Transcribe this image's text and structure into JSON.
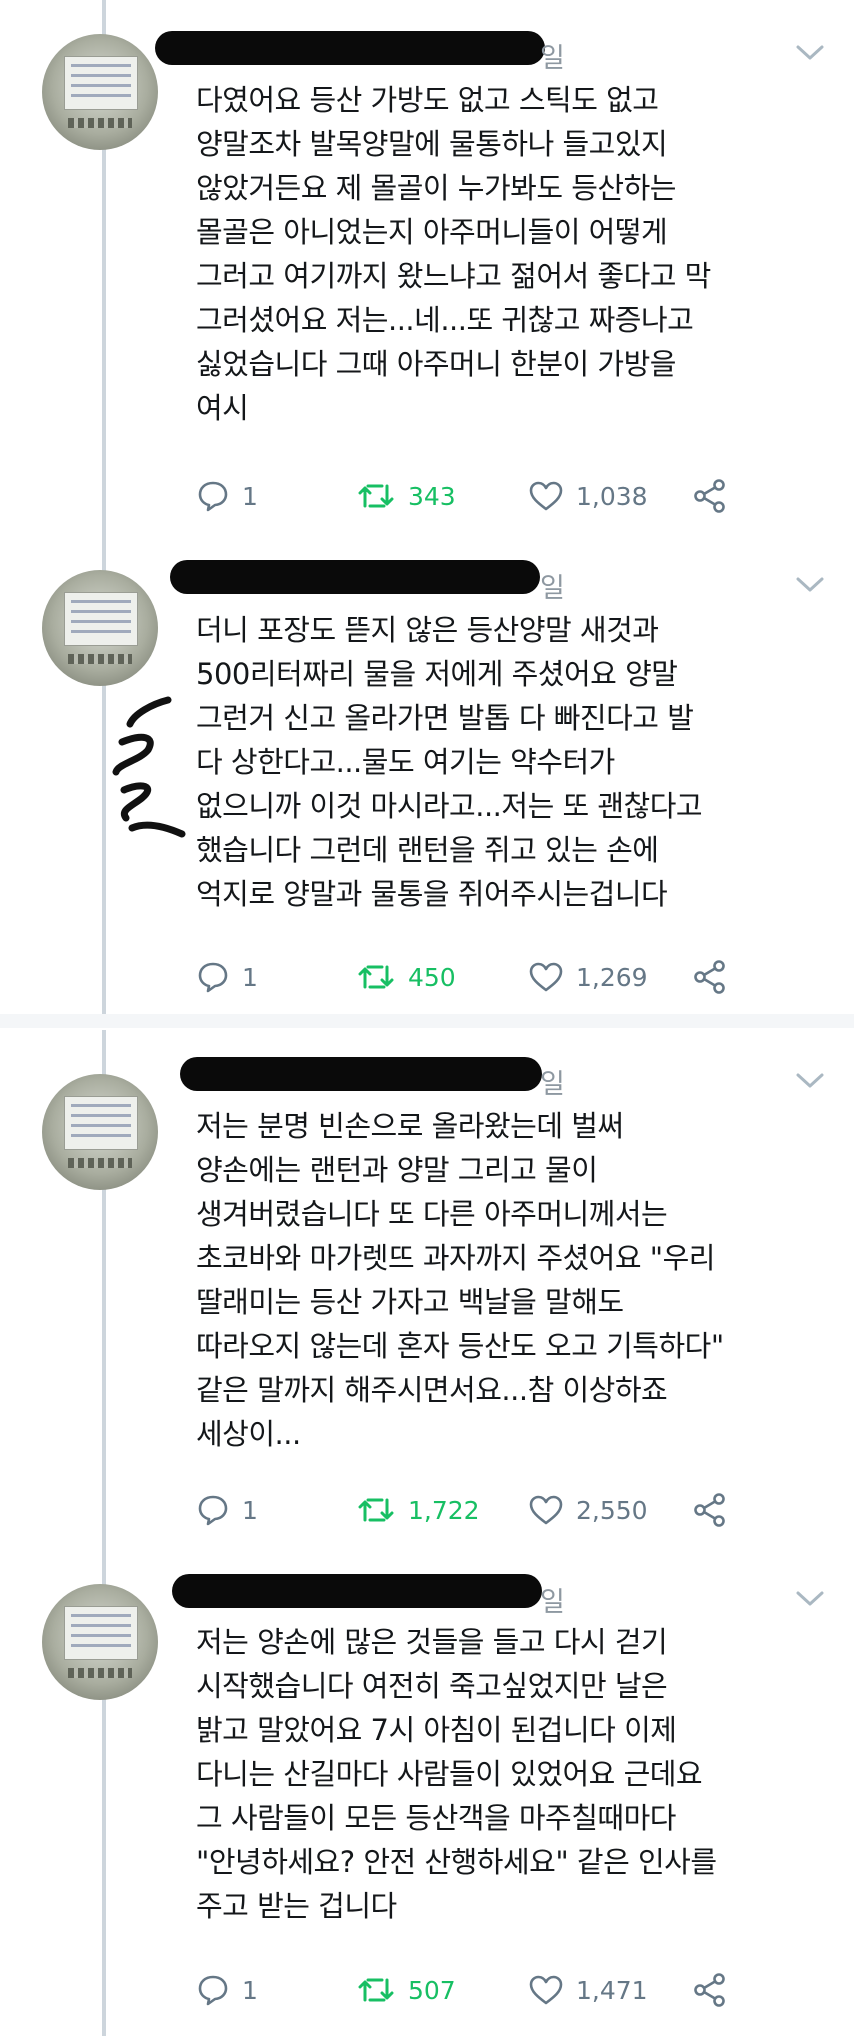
{
  "tweets": [
    {
      "date_suffix": "일",
      "text": "다였어요 등산 가방도 없고 스틱도 없고\n양말조차 발목양말에 물통하나 들고있지\n않았거든요 제 몰골이 누가봐도 등산하는\n몰골은 아니었는지 아주머니들이 어떻게\n그러고 여기까지 왔느냐고 젊어서 좋다고 막\n그러셨어요 저는...네...또 귀찮고 짜증나고\n싫었습니다 그때 아주머니 한분이 가방을\n여시",
      "replies": "1",
      "retweets": "343",
      "likes": "1,038"
    },
    {
      "date_suffix": "일",
      "text": "더니 포장도 뜯지 않은 등산양말 새것과\n500리터짜리 물을 저에게 주셨어요 양말\n그런거 신고 올라가면 발톱 다 빠진다고 발\n다 상한다고...물도 여기는 약수터가\n없으니까 이것 마시라고...저는 또 괜찮다고\n했습니다 그런데 랜턴을 쥐고 있는 손에\n억지로 양말과 물통을 쥐어주시는겁니다",
      "replies": "1",
      "retweets": "450",
      "likes": "1,269"
    },
    {
      "date_suffix": "일",
      "text": "저는 분명 빈손으로 올라왔는데 벌써\n양손에는 랜턴과 양말 그리고 물이\n생겨버렸습니다 또 다른 아주머니께서는\n초코바와 마가렛뜨 과자까지 주셨어요 \"우리\n딸래미는 등산 가자고 백날을 말해도\n따라오지 않는데 혼자 등산도 오고 기특하다\"\n같은 말까지 해주시면서요...참 이상하죠\n세상이...",
      "replies": "1",
      "retweets": "1,722",
      "likes": "2,550"
    },
    {
      "date_suffix": "일",
      "text": "저는 양손에 많은 것들을 들고 다시 걷기\n시작했습니다 여전히 죽고싶었지만 날은\n밝고 말았어요 7시 아침이 된겁니다 이제\n다니는 산길마다 사람들이 있었어요 근데요\n그 사람들이 모든 등산객을 마주칠때마다\n\"안녕하세요? 안전 산행하세요\" 같은 인사를\n주고 받는 겁니다",
      "replies": "1",
      "retweets": "507",
      "likes": "1,471"
    }
  ],
  "icons": {
    "reply": "reply-icon",
    "retweet": "retweet-icon",
    "like": "heart-icon",
    "share": "share-icon",
    "menu": "chevron-down-icon"
  },
  "colors": {
    "text": "#14171a",
    "muted": "#657786",
    "retweet_green": "#17bf63",
    "thread_line": "#cdd5dc"
  }
}
